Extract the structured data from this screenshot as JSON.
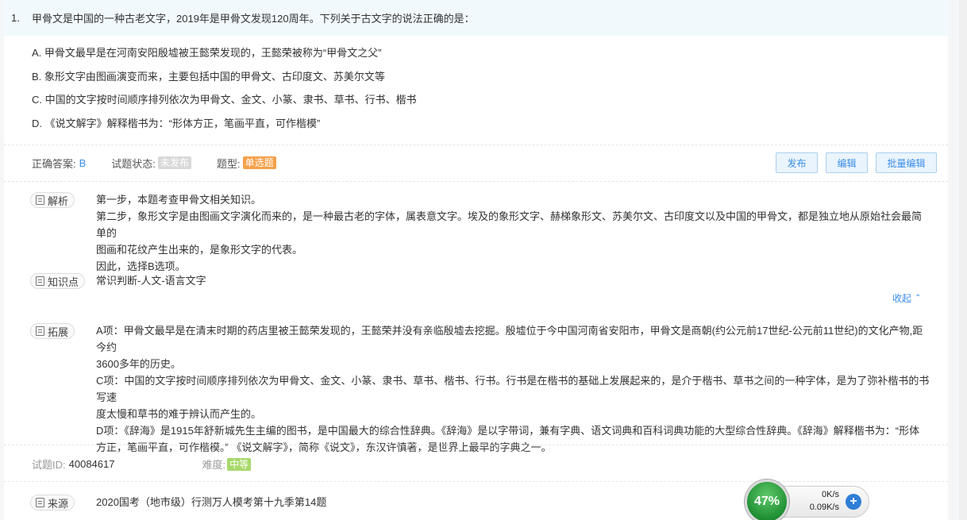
{
  "question": {
    "number": "1.",
    "stem": "甲骨文是中国的一种古老文字，2019年是甲骨文发现120周年。下列关于古文字的说法正确的是：",
    "options": [
      "A. 甲骨文最早是在河南安阳殷墟被王懿荣发现的，王懿荣被称为“甲骨文之父”",
      "B. 象形文字由图画演变而来，主要包括中国的甲骨文、古印度文、苏美尔文等",
      "C. 中国的文字按时间顺序排列依次为甲骨文、金文、小篆、隶书、草书、行书、楷书",
      "D. 《说文解字》解释楷书为：“形体方正，笔画平直，可作楷模”"
    ]
  },
  "meta": {
    "answer_label": "正确答案:",
    "answer_value": "B",
    "status_label": "试题状态:",
    "status_value": "未发布",
    "type_label": "题型:",
    "type_value": "单选题"
  },
  "buttons": {
    "publish": "发布",
    "edit": "编辑",
    "batch_edit": "批量编辑"
  },
  "analysis": {
    "tag": "解析",
    "lines": [
      "第一步，本题考查甲骨文相关知识。",
      "第二步，象形文字是由图画文字演化而来的，是一种最古老的字体，属表意文字。埃及的象形文字、赫梯象形文、苏美尔文、古印度文以及中国的甲骨文，都是独立地从原始社会最简单的",
      "图画和花纹产生出来的，是象形文字的代表。",
      "因此，选择B选项。"
    ]
  },
  "knowledge": {
    "tag": "知识点",
    "value": "常识判断-人文-语言文字"
  },
  "collapse_label": "收起",
  "extension": {
    "tag": "拓展",
    "lines": [
      "A项：甲骨文最早是在清末时期的药店里被王懿荣发现的，王懿荣并没有亲临殷墟去挖掘。殷墟位于今中国河南省安阳市，甲骨文是商朝(约公元前17世纪-公元前11世纪)的文化产物,距今约",
      "3600多年的历史。",
      "C项：中国的文字按时间顺序排列依次为甲骨文、金文、小篆、隶书、草书、楷书、行书。行书是在楷书的基础上发展起来的，是介于楷书、草书之间的一种字体，是为了弥补楷书的书写速",
      "度太慢和草书的难于辨认而产生的。",
      "D项：《辞海》是1915年舒新城先生主编的图书，是中国最大的综合性辞典。《辞海》是以字带词，兼有字典、语文词典和百科词典功能的大型综合性辞典。《辞海》解释楷书为：“形体",
      "方正，笔画平直，可作楷模。” 《说文解字》，简称《说文》，东汉许慎著，是世界上最早的字典之一。"
    ]
  },
  "footer": {
    "id_label": "试题ID:",
    "id_value": "40084617",
    "difficulty_label": "难度:",
    "difficulty_value": "中等"
  },
  "source": {
    "tag": "来源",
    "value": "2020国考（地市级）行测万人模考第十九季第14题"
  },
  "net_widget": {
    "percent": "47%",
    "up": "0K/s",
    "down": "0.09K/s"
  }
}
